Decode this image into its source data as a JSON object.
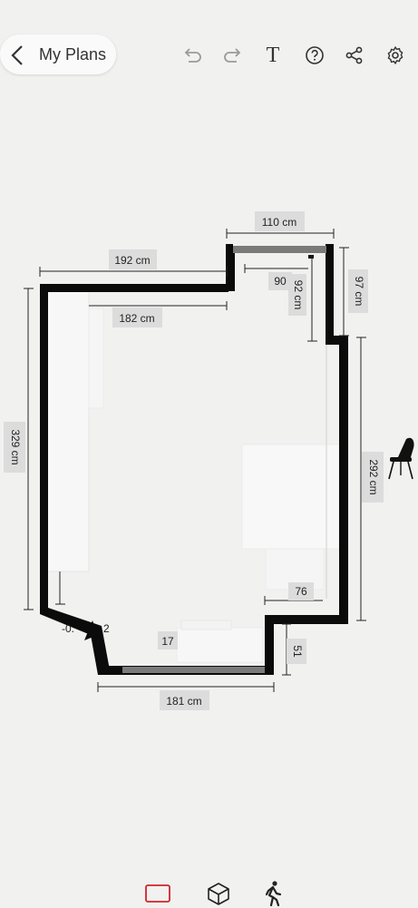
{
  "header": {
    "back_label": "My Plans",
    "tools": [
      "undo-icon",
      "redo-icon",
      "text-tool-icon",
      "help-icon",
      "share-icon",
      "settings-icon"
    ],
    "text_tool_glyph": "T"
  },
  "plan": {
    "dimensions": {
      "top_right_width": "110 cm",
      "top_left_width": "192 cm",
      "inner_top_width": "182 cm",
      "left_height": "329 cm",
      "right_height": "292 cm",
      "small_90": "90",
      "height_92": "92 cm",
      "height_97": "97 cm",
      "right_76": "76",
      "bottom_width": "181 cm",
      "right_51": "51",
      "partial_17": "17",
      "diagonal_label": "-0.",
      "diagonal_label_2": "2"
    },
    "colors": {
      "wall": "#0b0b0b",
      "window": "#7a7a7a",
      "label_bg": "#dcdcdc"
    }
  },
  "bottom_nav": {
    "tabs": [
      "plan-2d-icon",
      "view-3d-icon",
      "walk-icon"
    ],
    "active_color": "#d2232a"
  }
}
